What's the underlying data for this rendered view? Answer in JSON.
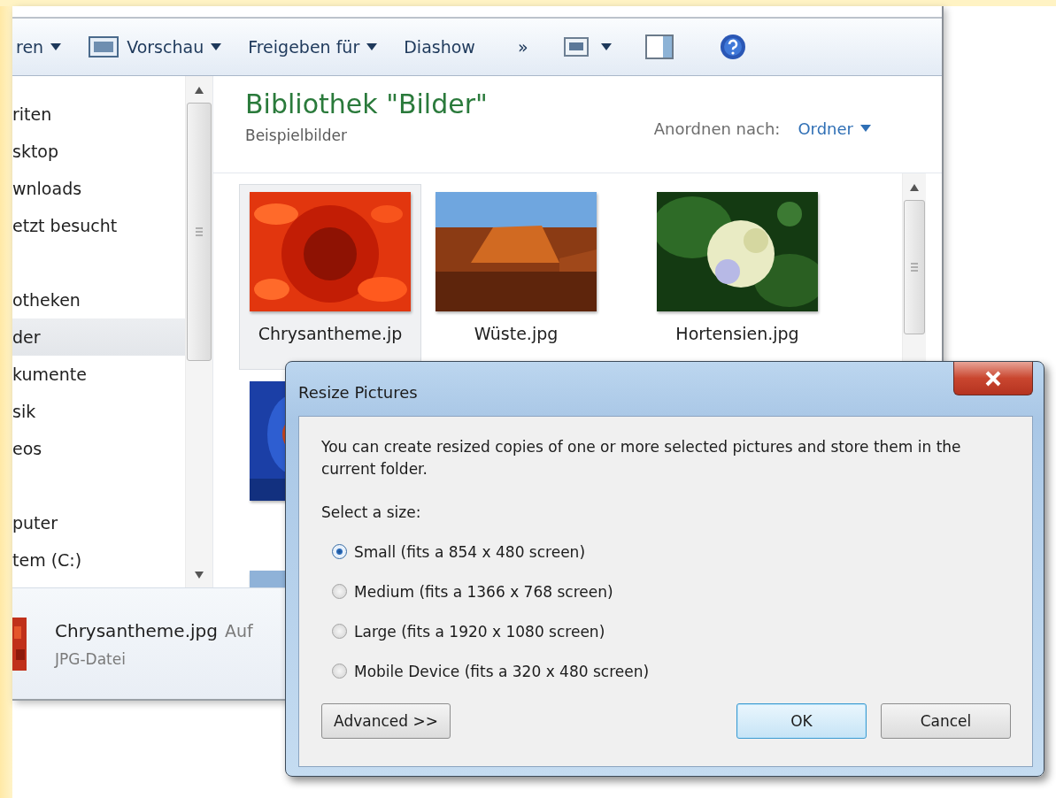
{
  "toolbar": {
    "items": [
      {
        "kind": "menu",
        "label": "ren"
      },
      {
        "kind": "icon_menu",
        "label": "Vorschau"
      },
      {
        "kind": "menu",
        "label": "Freigeben für"
      },
      {
        "kind": "plain",
        "label": "Diashow"
      },
      {
        "kind": "plain",
        "label": "»"
      }
    ]
  },
  "navigation": {
    "groups": [
      {
        "label": "riten",
        "selected": false,
        "children": [
          {
            "label": "sktop",
            "selected": false
          },
          {
            "label": "wnloads",
            "selected": false
          },
          {
            "label": "etzt besucht",
            "selected": false
          }
        ]
      },
      {
        "label": "otheken",
        "selected": false,
        "children": [
          {
            "label": "der",
            "selected": true
          },
          {
            "label": "kumente",
            "selected": false
          },
          {
            "label": "sik",
            "selected": false
          },
          {
            "label": "eos",
            "selected": false
          }
        ]
      },
      {
        "label": "puter",
        "selected": false,
        "children": [
          {
            "label": "tem (C:)",
            "selected": false
          }
        ]
      }
    ]
  },
  "library": {
    "title": "Bibliothek \"Bilder\"",
    "subtitle": "Beispielbilder",
    "arrange_label": "Anordnen nach:",
    "arrange_value": "Ordner"
  },
  "thumbnails": [
    {
      "kind": "picture",
      "name": "Chrysantheme.jp",
      "selected": true
    },
    {
      "kind": "picture",
      "name": "Wüste.jpg",
      "selected": false
    },
    {
      "kind": "picture",
      "name": "Hortensien.jpg",
      "selected": false
    },
    {
      "kind": "picture"
    },
    {
      "kind": "picture"
    }
  ],
  "details": {
    "name": "Chrysantheme.jpg",
    "extra": "Auf",
    "type": "JPG-Datei"
  },
  "dialog": {
    "title": "Resize Pictures",
    "description": "You can create resized copies of one or more selected pictures and store them in the current folder.",
    "prompt": "Select a size:",
    "options": [
      {
        "label": "Small (fits a 854 x 480 screen)",
        "selected": true
      },
      {
        "label": "Medium (fits a 1366 x 768 screen)",
        "selected": false
      },
      {
        "label": "Large (fits a 1920 x 1080 screen)",
        "selected": false
      },
      {
        "label": "Mobile Device (fits a 320 x 480 screen)",
        "selected": false
      }
    ],
    "advanced": "Advanced >>",
    "buttons": [
      {
        "label": "OK",
        "kind": "default"
      },
      {
        "label": "Cancel",
        "kind": "normal"
      }
    ]
  }
}
